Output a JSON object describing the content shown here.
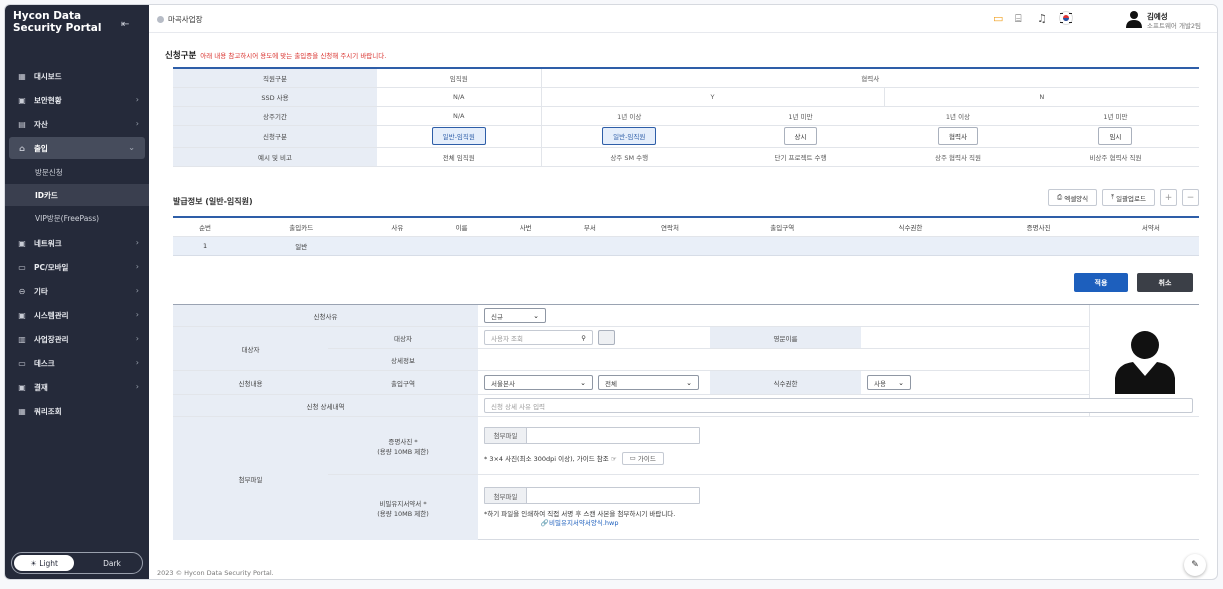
{
  "app": {
    "title": "Hycon Data Security Portal"
  },
  "sidebar": {
    "items": [
      {
        "label": "대시보드",
        "icon": "dashboard-icon",
        "glyph": "▦",
        "chevron": false
      },
      {
        "label": "보안현황",
        "icon": "monitor-icon",
        "glyph": "▣",
        "chevron": true
      },
      {
        "label": "자산",
        "icon": "asset-icon",
        "glyph": "▤",
        "chevron": true
      },
      {
        "label": "출입",
        "icon": "door-icon",
        "glyph": "⌂",
        "chevron": true,
        "active": true
      },
      {
        "label": "네트워크",
        "icon": "network-icon",
        "glyph": "▣",
        "chevron": true
      },
      {
        "label": "PC/모바일",
        "icon": "pc-mobile-icon",
        "glyph": "▭",
        "chevron": true
      },
      {
        "label": "기타",
        "icon": "etc-icon",
        "glyph": "⊖",
        "chevron": true
      },
      {
        "label": "시스템관리",
        "icon": "system-icon",
        "glyph": "▣",
        "chevron": true
      },
      {
        "label": "사업장관리",
        "icon": "building-icon",
        "glyph": "▥",
        "chevron": true
      },
      {
        "label": "데스크",
        "icon": "desk-icon",
        "glyph": "▭",
        "chevron": true
      },
      {
        "label": "결재",
        "icon": "approval-icon",
        "glyph": "▣",
        "chevron": true
      },
      {
        "label": "쿼리조회",
        "icon": "query-icon",
        "glyph": "▦",
        "chevron": false
      }
    ],
    "sub_items": [
      "방문신청",
      "ID카드",
      "VIP방문(FreePass)"
    ],
    "theme": {
      "light": "Light",
      "dark": "Dark"
    }
  },
  "topbar": {
    "site": "마곡사업장",
    "user_name": "김예성",
    "user_dept": "소프트웨어 개발2팀"
  },
  "apply_type": {
    "title": "신청구분",
    "note": "아래 내용 참고하시어 용도에 맞는 출입증을 신청해 주시기 바랍니다.",
    "rows": {
      "row1": [
        "직원구분",
        "임직원",
        "협력사"
      ],
      "row2": [
        "SSD 사용",
        "N/A",
        "Y",
        "N"
      ],
      "row3": [
        "상주기간",
        "N/A",
        "1년 이상",
        "1년 미만",
        "1년 이상",
        "1년 미만"
      ],
      "row4_label": "신청구분",
      "row4_buttons": [
        "일반-임직원",
        "일반-임직원",
        "상시",
        "협력사",
        "임시"
      ],
      "row5": [
        "예시 및 비고",
        "전체 임직원",
        "상주 SM 수행",
        "단기 프로젝트 수행",
        "상주 협력사 직원",
        "비상주 협력사 직원"
      ]
    }
  },
  "issue": {
    "title": "발급정보 (일반-임직원)",
    "excel_form": "엑셀양식",
    "bulk_upload": "일괄업로드",
    "add": "+",
    "remove": "−",
    "columns": [
      "순번",
      "출입카드",
      "사유",
      "이름",
      "사번",
      "부서",
      "연락처",
      "출입구역",
      "식수권한",
      "증명사진",
      "서약서"
    ],
    "rows": [
      {
        "no": "1",
        "card": "일반"
      }
    ]
  },
  "actions": {
    "apply": "적용",
    "cancel": "취소"
  },
  "form": {
    "reason_label": "신청사유",
    "reason_value": "신규",
    "target_group": "대상자",
    "target_label": "대상자",
    "target_placeholder": "사용자 조회",
    "english_name_label": "영문이름",
    "detail_label": "상세정보",
    "content_group": "신청내용",
    "zone_label": "출입구역",
    "zone_value1": "서울본사",
    "zone_value2": "전체",
    "meal_label": "식수권한",
    "meal_value": "사용",
    "apply_detail_label": "신청 상세내역",
    "apply_detail_placeholder": "신청 상세 사유 입력",
    "attach_group": "첨부파일",
    "photo_label": "증명사진 *",
    "photo_limit": "(용량 10MB 제한)",
    "attach_button": "첨부파일",
    "photo_hint": "* 3×4 사진(최소 300dpi 이상), 가이드 참조 ☞",
    "guide_button": "가이드",
    "nda_label": "비밀유지서약서 *",
    "nda_limit": "(용량 10MB 제한)",
    "nda_hint": "*하기 파일을 인쇄하여 직접 서명 후 스캔 사본을 첨부하시기 바랍니다.",
    "nda_file": "비밀유지서약서양식.hwp"
  },
  "footer": "2023 © Hycon Data Security Portal."
}
